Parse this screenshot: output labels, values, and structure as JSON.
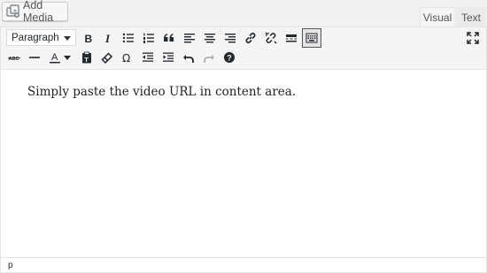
{
  "toolbar_top": {
    "add_media_label": "Add Media",
    "tabs": [
      {
        "label": "Visual",
        "active": true
      },
      {
        "label": "Text",
        "active": false
      }
    ]
  },
  "format": {
    "selected": "Paragraph"
  },
  "toolbar_row1_icons": [
    "bold-icon",
    "italic-icon",
    "bullet-list-icon",
    "numbered-list-icon",
    "blockquote-icon",
    "align-left-icon",
    "align-center-icon",
    "align-right-icon",
    "insert-link-icon",
    "remove-link-icon",
    "read-more-icon",
    "toolbar-toggle-icon",
    "fullscreen-icon"
  ],
  "toolbar_row2_icons": [
    "strikethrough-icon",
    "horizontal-line-icon",
    "text-color-icon",
    "paste-as-text-icon",
    "clear-formatting-icon",
    "special-character-icon",
    "outdent-icon",
    "indent-icon",
    "undo-icon",
    "redo-icon",
    "help-icon"
  ],
  "editor": {
    "content": "Simply paste the video URL in content area."
  },
  "status": {
    "path": "p"
  },
  "colors": {
    "toolbar_bg": "#f5f5f5",
    "border": "#e5e5e5",
    "icon": "#23282d",
    "disabled_icon": "#b0b0b0"
  }
}
